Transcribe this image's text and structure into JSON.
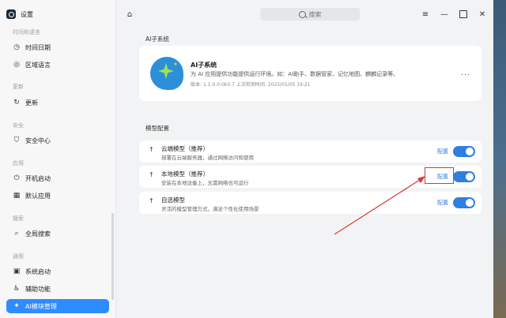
{
  "app": {
    "title": "设置"
  },
  "sidebar": {
    "sections": [
      {
        "label": "时间和语言"
      },
      {
        "label": "更新"
      },
      {
        "label": "安全"
      },
      {
        "label": "应用"
      },
      {
        "label": "搜索"
      },
      {
        "label": "通用"
      }
    ],
    "items": [
      {
        "label": "时间日期",
        "icon": "clock-icon"
      },
      {
        "label": "区域语言",
        "icon": "globe-icon"
      },
      {
        "label": "更新",
        "icon": "refresh-icon"
      },
      {
        "label": "安全中心",
        "icon": "shield-icon"
      },
      {
        "label": "开机启动",
        "icon": "power-icon"
      },
      {
        "label": "默认应用",
        "icon": "grid-icon"
      },
      {
        "label": "全局搜索",
        "icon": "search-icon"
      },
      {
        "label": "系统启动",
        "icon": "boot-icon"
      },
      {
        "label": "辅助功能",
        "icon": "accessibility-icon"
      },
      {
        "label": "AI模块管理",
        "icon": "ai-icon",
        "active": true
      }
    ]
  },
  "topbar": {
    "search_placeholder": "搜索"
  },
  "ai_section": {
    "title": "AI子系统",
    "name": "AI子系统",
    "description": "为 AI 应用提供功能提供运行环境。如：AI助手、数据管家、记忆地图、麒麟记录等。",
    "meta": "版本: 1.1.0.0-0k0.7    上次检测时间: 2025/05/05 19:21",
    "more": "..."
  },
  "model_section": {
    "title": "模型配置",
    "rows": [
      {
        "name": "云端模型（推荐）",
        "desc": "部署在云端服务器，通过网络访问和使用",
        "config": "配置",
        "enabled": true
      },
      {
        "name": "本地模型（推荐）",
        "desc": "安装在本地设备上，无需网络也可运行",
        "config": "配置",
        "enabled": true,
        "highlighted": true
      },
      {
        "name": "自选模型",
        "desc": "灵活的模型管理方式，满足个性化使用场景",
        "config": "配置",
        "enabled": true
      }
    ]
  },
  "colors": {
    "accent": "#2f7fe0",
    "active_nav": "#2f8cff",
    "annotation": "#d23a3a"
  }
}
